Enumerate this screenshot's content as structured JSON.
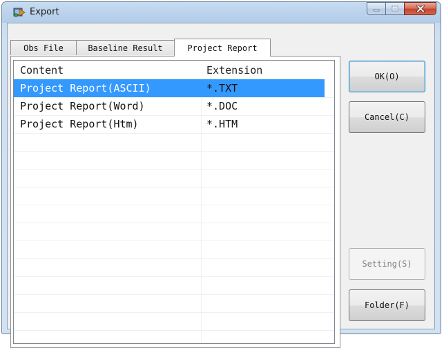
{
  "window": {
    "title": "Export",
    "icon": "export-app-icon",
    "caption_buttons": [
      "minimize-icon",
      "maximize-icon",
      "close-icon"
    ]
  },
  "tabs": [
    {
      "label": "Obs File",
      "active": false
    },
    {
      "label": "Baseline Result",
      "active": false
    },
    {
      "label": "Project Report",
      "active": true
    }
  ],
  "list": {
    "columns": [
      "Content",
      "Extension"
    ],
    "rows": [
      {
        "content": "Project Report(ASCII)",
        "extension": "*.TXT",
        "selected": true
      },
      {
        "content": "Project Report(Word)",
        "extension": "*.DOC",
        "selected": false
      },
      {
        "content": "Project Report(Htm)",
        "extension": "*.HTM",
        "selected": false
      }
    ],
    "selection_color": "#3399ff"
  },
  "buttons": {
    "ok": "OK(O)",
    "cancel": "Cancel(C)",
    "setting": "Setting(S)",
    "folder": "Folder(F)"
  }
}
